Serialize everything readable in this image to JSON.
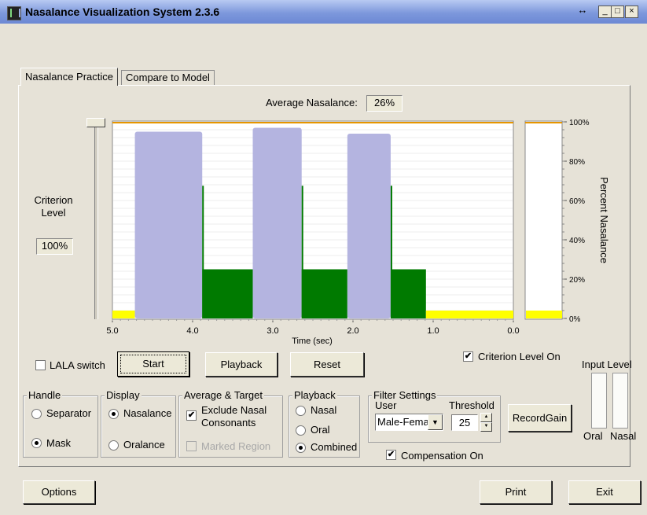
{
  "window": {
    "title": "Nasalance Visualization System 2.3.6",
    "restore_glyph": "↔",
    "min_glyph": "_",
    "max_glyph": "□",
    "close_glyph": "×"
  },
  "tabs": [
    {
      "label": "Nasalance Practice",
      "active": true
    },
    {
      "label": "Compare to Model",
      "active": false
    }
  ],
  "average": {
    "label": "Average Nasalance:",
    "value": "26%"
  },
  "criterion": {
    "label_line1": "Criterion",
    "label_line2": "Level",
    "value": "100%",
    "slider_level": 1.0
  },
  "colors": {
    "nasal_bar": "#b4b4e0",
    "oral_bar": "#007a00",
    "baseline": "#ffff00",
    "criterion_line": "#e69500"
  },
  "chart_data": {
    "type": "bar",
    "title": "",
    "xlabel": "Time (sec)",
    "ylabel": "Percent Nasalance",
    "xlim": [
      5.0,
      0.0
    ],
    "ylim": [
      0,
      100
    ],
    "x_ticks": [
      "5.0",
      "4.0",
      "3.0",
      "2.0",
      "1.0",
      "0.0"
    ],
    "y_ticks": [
      "100%",
      "80%",
      "60%",
      "40%",
      "20%",
      "0%"
    ],
    "segments": [
      {
        "kind": "baseline",
        "x0": 5.0,
        "x1": 4.72,
        "value": 4
      },
      {
        "kind": "nasal",
        "x0": 4.72,
        "x1": 3.88,
        "value": 95
      },
      {
        "kind": "oral",
        "x0": 3.88,
        "x1": 3.25,
        "value": 25
      },
      {
        "kind": "nasal",
        "x0": 3.25,
        "x1": 2.64,
        "value": 97
      },
      {
        "kind": "oral",
        "x0": 2.64,
        "x1": 2.07,
        "value": 25
      },
      {
        "kind": "nasal",
        "x0": 2.07,
        "x1": 1.53,
        "value": 94
      },
      {
        "kind": "oral",
        "x0": 1.53,
        "x1": 1.09,
        "value": 25
      },
      {
        "kind": "baseline",
        "x0": 1.09,
        "x1": 0.0,
        "value": 4
      }
    ],
    "side_bar_value": 4,
    "criterion_line": 100
  },
  "lala": {
    "label": "LALA switch",
    "checked": false
  },
  "buttons": {
    "start": "Start",
    "playback": "Playback",
    "reset": "Reset",
    "record_gain": "RecordGain",
    "options": "Options",
    "print": "Print",
    "exit": "Exit"
  },
  "criterion_on": {
    "label": "Criterion Level On",
    "checked": true
  },
  "input_level": {
    "title": "Input Level",
    "oral": "Oral",
    "nasal": "Nasal",
    "oral_level": 0,
    "nasal_level": 0
  },
  "handle": {
    "title": "Handle",
    "options": [
      "Separator",
      "Mask"
    ],
    "selected": 1
  },
  "display": {
    "title": "Display",
    "options": [
      "Nasalance",
      "Oralance"
    ],
    "selected": 0
  },
  "avg_target": {
    "title": "Average & Target",
    "exclude_line1": "Exclude Nasal",
    "exclude_line2": "Consonants",
    "exclude_checked": true,
    "marked_region": "Marked Region",
    "marked_checked": false
  },
  "playback_group": {
    "title": "Playback",
    "options": [
      "Nasal",
      "Oral",
      "Combined"
    ],
    "selected": 2
  },
  "filter": {
    "title": "Filter Settings",
    "user_label": "User",
    "user_value": "Male-Female",
    "threshold_label": "Threshold",
    "threshold_value": "25"
  },
  "compensation": {
    "label": "Compensation On",
    "checked": true
  }
}
